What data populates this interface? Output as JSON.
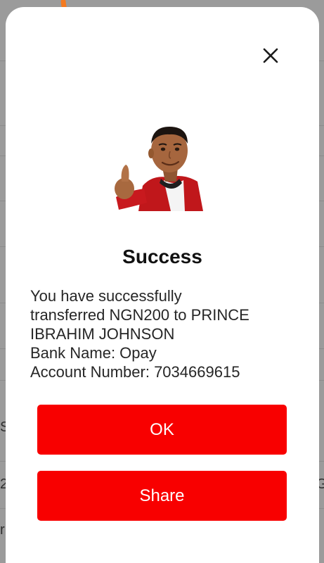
{
  "dialog": {
    "title": "Success",
    "message_lines": [
      "You have successfully",
      "transferred NGN200 to PRINCE",
      "IBRAHIM JOHNSON",
      "Bank Name: Opay",
      "Account Number: 7034669615"
    ],
    "ok_label": "OK",
    "share_label": "Share",
    "close_icon": "close-icon",
    "avatar": "thumbs-up-character-avatar"
  },
  "colors": {
    "accent": "#f80000",
    "dialog_background": "#ffffff",
    "overlay": "#9b9b9b",
    "text": "#262626"
  },
  "background": {
    "fragments": [
      "S",
      "2",
      "r",
      "G"
    ]
  }
}
